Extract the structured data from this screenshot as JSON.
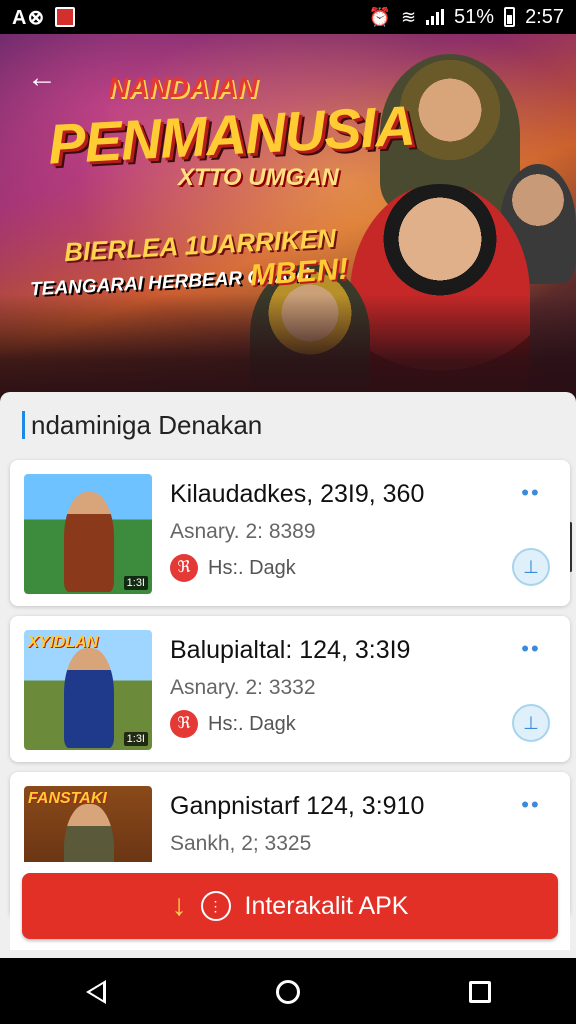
{
  "status_bar": {
    "brand": "A⊗",
    "battery_percent": "51%",
    "time": "2:57"
  },
  "hero": {
    "title_small": "NANDAIAN",
    "title": "PENMANUSIA",
    "title_sub": "XTTO UMGAN",
    "tagline_1": "BIERLEA 1UARRIKEN",
    "tagline_2": "TEANGARAI HERBEAR CAAMI",
    "tagline_3": "MBEN!"
  },
  "section": {
    "title": "ndaminiga Denakan"
  },
  "games": [
    {
      "title": "Kilaudadkes, 23I9, 360",
      "subtitle": "Asnary. 2: 8389",
      "tag": "Hs:. Dagk",
      "thumb_badge": "1:3I"
    },
    {
      "title": "Balupialtal: 124, 3:3I9",
      "subtitle": "Asnary. 2: 3332",
      "tag": "Hs:. Dagk",
      "thumb_banner": "XYIDLAN",
      "thumb_badge": "1:3I"
    },
    {
      "title": "Ganpnistarf 124, 3:910",
      "subtitle": "Sankh, 2; 3325",
      "thumb_banner": "FANSTAKI"
    }
  ],
  "cta": {
    "label": "Interakalit APK"
  },
  "icons": {
    "back": "arrow-left",
    "more": "more-dots",
    "install": "install",
    "tag": "tag",
    "cta_download": "download-arrow",
    "cta_info": "info-circle"
  },
  "colors": {
    "accent_blue": "#1e88e5",
    "cta_red": "#e23027",
    "tag_red": "#e53935"
  }
}
